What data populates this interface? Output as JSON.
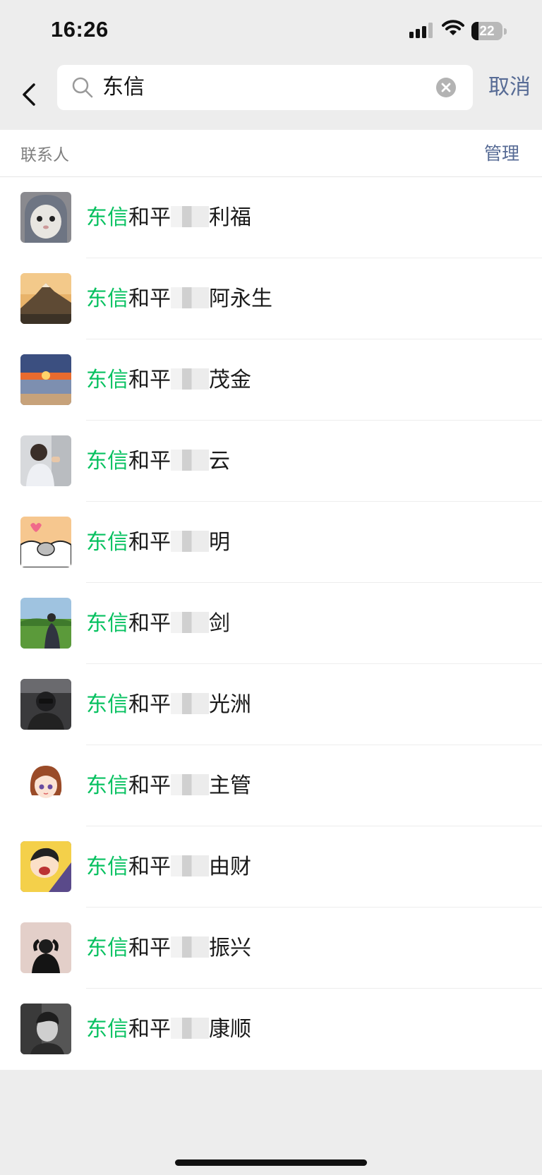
{
  "status_bar": {
    "time": "16:26",
    "battery_level": "22"
  },
  "search": {
    "query": "东信",
    "cancel_label": "取消"
  },
  "section": {
    "title": "联系人",
    "manage_label": "管理"
  },
  "contacts": [
    {
      "highlight": "东信",
      "prefix": "和平",
      "suffix": "利福",
      "avatar": "gray-cat-avatar"
    },
    {
      "highlight": "东信",
      "prefix": "和平",
      "suffix": "阿永生",
      "avatar": "mountain-avatar"
    },
    {
      "highlight": "东信",
      "prefix": "和平",
      "suffix": "茂金",
      "avatar": "sunset-beach-avatar"
    },
    {
      "highlight": "东信",
      "prefix": "和平",
      "suffix": "云",
      "avatar": "child-photo-avatar"
    },
    {
      "highlight": "东信",
      "prefix": "和平",
      "suffix": "明",
      "avatar": "cartoon-hamster-avatar"
    },
    {
      "highlight": "东信",
      "prefix": "和平",
      "suffix": "剑",
      "avatar": "grassland-avatar"
    },
    {
      "highlight": "东信",
      "prefix": "和平",
      "suffix": "光洲",
      "avatar": "man-in-car-avatar"
    },
    {
      "highlight": "东信",
      "prefix": "和平",
      "suffix": "主管",
      "avatar": "anime-girl-avatar"
    },
    {
      "highlight": "东信",
      "prefix": "和平",
      "suffix": "由财",
      "avatar": "cartoon-boy-avatar"
    },
    {
      "highlight": "东信",
      "prefix": "和平",
      "suffix": "振兴",
      "avatar": "dark-figure-avatar"
    },
    {
      "highlight": "东信",
      "prefix": "和平",
      "suffix": "康顺",
      "avatar": "bw-portrait-avatar"
    }
  ],
  "colors": {
    "highlight": "#07c160",
    "link": "#576b95",
    "background": "#ededed"
  }
}
